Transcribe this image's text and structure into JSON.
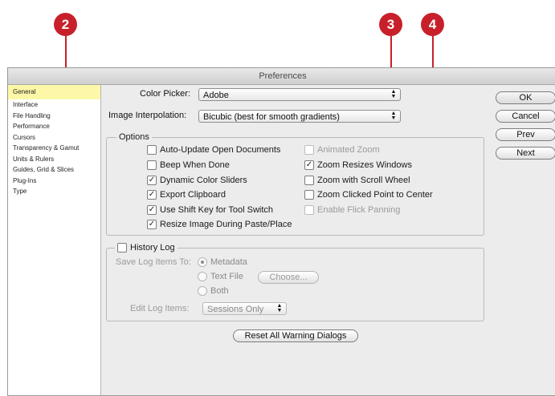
{
  "callouts": {
    "c2": "2",
    "c3": "3",
    "c4": "4"
  },
  "window": {
    "title": "Preferences"
  },
  "sidebar": {
    "items": [
      {
        "label": "General"
      },
      {
        "label": "Interface"
      },
      {
        "label": "File Handling"
      },
      {
        "label": "Performance"
      },
      {
        "label": "Cursors"
      },
      {
        "label": "Transparency & Gamut"
      },
      {
        "label": "Units & Rulers"
      },
      {
        "label": "Guides, Grid & Slices"
      },
      {
        "label": "Plug-Ins"
      },
      {
        "label": "Type"
      }
    ]
  },
  "general": {
    "color_picker_label": "Color Picker:",
    "color_picker_value": "Adobe",
    "interp_label": "Image Interpolation:",
    "interp_value": "Bicubic (best for smooth gradients)"
  },
  "options": {
    "title": "Options",
    "auto_update": "Auto-Update Open Documents",
    "beep": "Beep When Done",
    "dynamic_sliders": "Dynamic Color Sliders",
    "export_clipboard": "Export Clipboard",
    "shift_key": "Use Shift Key for Tool Switch",
    "resize_paste": "Resize Image During Paste/Place",
    "animated_zoom": "Animated Zoom",
    "zoom_resizes": "Zoom Resizes Windows",
    "zoom_scroll": "Zoom with Scroll Wheel",
    "zoom_clicked": "Zoom Clicked Point to Center",
    "flick_panning": "Enable Flick Panning",
    "check_mark": "✓"
  },
  "history": {
    "title": "History Log",
    "save_to_label": "Save Log Items To:",
    "metadata": "Metadata",
    "text_file": "Text File",
    "choose": "Choose...",
    "both": "Both",
    "edit_label": "Edit Log Items:",
    "edit_value": "Sessions Only"
  },
  "reset_label": "Reset All Warning Dialogs",
  "buttons": {
    "ok": "OK",
    "cancel": "Cancel",
    "prev": "Prev",
    "next": "Next"
  },
  "colors": {
    "callout": "#c8202a",
    "selected_item": "#fdf8a8"
  }
}
